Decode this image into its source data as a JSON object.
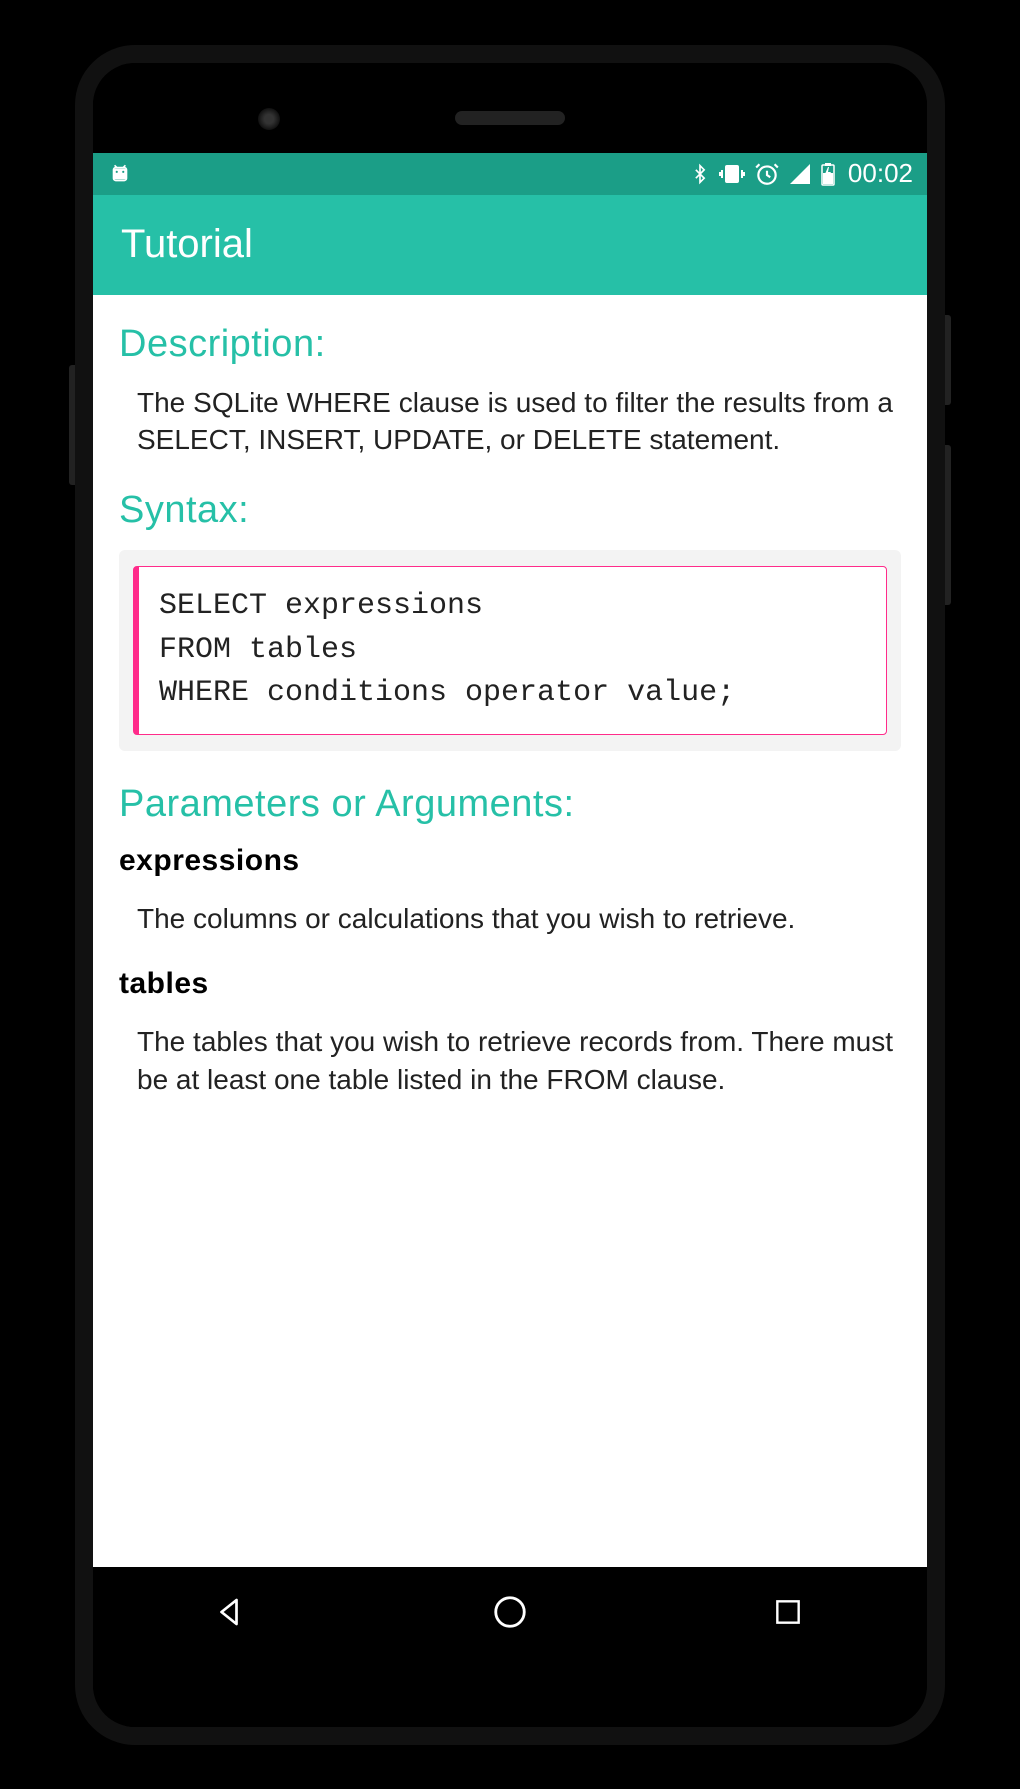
{
  "status_bar": {
    "time": "00:02"
  },
  "app_bar": {
    "title": "Tutorial"
  },
  "content": {
    "description_heading": "Description:",
    "description_text": "The SQLite WHERE clause is used to filter the results from a SELECT, INSERT, UPDATE, or DELETE statement.",
    "syntax_heading": "Syntax:",
    "syntax_code": "SELECT expressions\nFROM tables\nWHERE conditions operator value;",
    "params_heading": "Parameters or Arguments:",
    "params": [
      {
        "name": "expressions",
        "text": "The columns or calculations that you wish to retrieve."
      },
      {
        "name": "tables",
        "text": "The tables that you wish to retrieve records from. There must be at least one table listed in the FROM clause."
      }
    ]
  }
}
